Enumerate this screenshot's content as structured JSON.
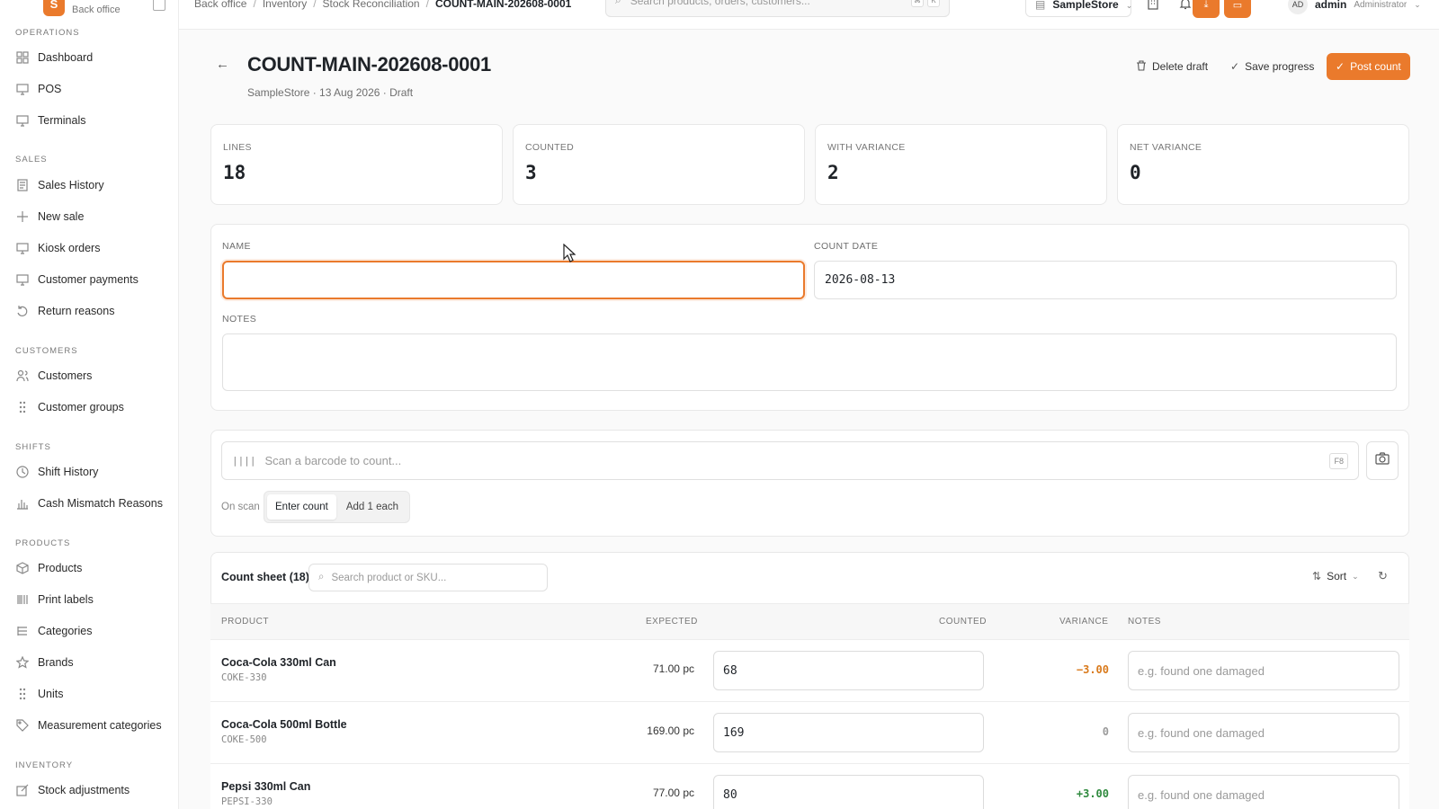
{
  "sidebar": {
    "logo_letter": "S",
    "subtitle": "Back office",
    "sections": {
      "operations": "OPERATIONS",
      "sales": "SALES",
      "customers": "CUSTOMERS",
      "shifts": "SHIFTS",
      "products": "PRODUCTS",
      "inventory": "INVENTORY"
    },
    "items": {
      "dashboard": "Dashboard",
      "pos": "POS",
      "terminals": "Terminals",
      "sales_history": "Sales History",
      "new_sale": "New sale",
      "kiosk_orders": "Kiosk orders",
      "customer_payments": "Customer payments",
      "return_reasons": "Return reasons",
      "customers": "Customers",
      "customer_groups": "Customer groups",
      "shift_history": "Shift History",
      "cash_mismatch": "Cash Mismatch Reasons",
      "products": "Products",
      "print_labels": "Print labels",
      "categories": "Categories",
      "brands": "Brands",
      "units": "Units",
      "measurement_categories": "Measurement categories",
      "stock_adjustments": "Stock adjustments"
    }
  },
  "topbar": {
    "breadcrumbs": [
      "Back office",
      "Inventory",
      "Stock Reconciliation",
      "COUNT-MAIN-202608-0001"
    ],
    "search_placeholder": "Search products, orders, customers...",
    "kbd1": "⌘",
    "kbd2": "K",
    "store": "SampleStore",
    "user_initials": "AD",
    "user_name": "admin",
    "user_role": "Administrator"
  },
  "header": {
    "title": "COUNT-MAIN-202608-0001",
    "subtitle": "SampleStore · 13 Aug 2026 · Draft",
    "delete_label": "Delete draft",
    "save_label": "Save progress",
    "post_label": "Post count"
  },
  "stats": [
    {
      "label": "LINES",
      "value": "18"
    },
    {
      "label": "COUNTED",
      "value": "3"
    },
    {
      "label": "WITH VARIANCE",
      "value": "2"
    },
    {
      "label": "NET VARIANCE",
      "value": "0"
    }
  ],
  "form": {
    "name_label": "NAME",
    "name_value": "",
    "date_label": "COUNT DATE",
    "date_value": "2026-08-13",
    "notes_label": "NOTES"
  },
  "scan": {
    "placeholder": "Scan a barcode to count...",
    "shortcut": "F8",
    "on_scan_label": "On scan",
    "mode_enter": "Enter count",
    "mode_add": "Add 1 each"
  },
  "sheet": {
    "title": "Count sheet (18)",
    "search_placeholder": "Search product or SKU...",
    "sort_label": "Sort",
    "columns": {
      "product": "PRODUCT",
      "expected": "EXPECTED",
      "counted": "COUNTED",
      "variance": "VARIANCE",
      "notes": "NOTES"
    },
    "rows": [
      {
        "name": "Coca-Cola 330ml Can",
        "sku": "COKE-330",
        "expected": "71.00 pc",
        "counted": "68",
        "variance": "−3.00",
        "variance_color": "#d97a1c",
        "note_placeholder": "e.g. found one damaged"
      },
      {
        "name": "Coca-Cola 500ml Bottle",
        "sku": "COKE-500",
        "expected": "169.00 pc",
        "counted": "169",
        "variance": "0",
        "variance_color": "#9a9a9a",
        "note_placeholder": "e.g. found one damaged"
      },
      {
        "name": "Pepsi 330ml Can",
        "sku": "PEPSI-330",
        "expected": "77.00 pc",
        "counted": "80",
        "variance": "+3.00",
        "variance_color": "#2f8a3e",
        "note_placeholder": "e.g. found one damaged"
      }
    ]
  },
  "colors": {
    "accent": "#ea7a2c"
  }
}
